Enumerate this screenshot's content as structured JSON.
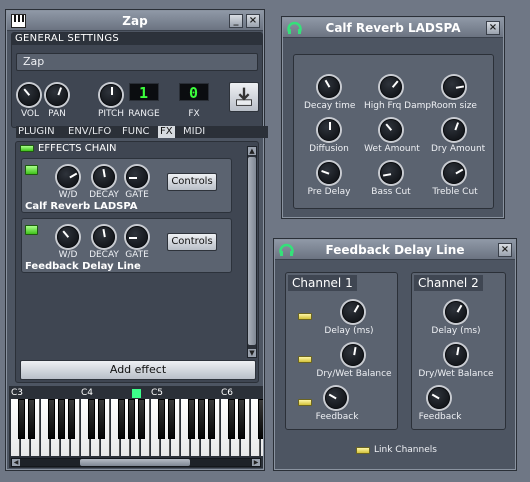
{
  "zap": {
    "title": "Zap",
    "minimize": "_",
    "close": "×",
    "general_settings": "GENERAL SETTINGS",
    "name_value": "Zap",
    "knobs": {
      "vol": "VOL",
      "pan": "PAN",
      "pitch": "PITCH"
    },
    "range_label": "RANGE",
    "range_value": "1",
    "fx_label": "FX",
    "fx_value": "0",
    "tabs": [
      "PLUGIN",
      "ENV/LFO",
      "FUNC",
      "FX",
      "MIDI"
    ],
    "effects_chain_label": "EFFECTS CHAIN",
    "effects": [
      {
        "name": "Calf Reverb LADSPA",
        "wd": "W/D",
        "decay": "DECAY",
        "gate": "GATE",
        "controls": "Controls"
      },
      {
        "name": "Feedback Delay Line",
        "wd": "W/D",
        "decay": "DECAY",
        "gate": "GATE",
        "controls": "Controls"
      }
    ],
    "add_effect": "Add effect",
    "piano_labels": [
      "C3",
      "C4",
      "C5",
      "C6"
    ]
  },
  "reverb": {
    "title": "Calf Reverb LADSPA",
    "close": "×",
    "knobs": [
      "Decay time",
      "High Frq Damp",
      "Room size",
      "Diffusion",
      "Wet Amount",
      "Dry Amount",
      "Pre Delay",
      "Bass Cut",
      "Treble Cut"
    ]
  },
  "delay": {
    "title": "Feedback Delay Line",
    "close": "×",
    "channel1": "Channel 1",
    "channel2": "Channel 2",
    "knob_labels": [
      "Delay (ms)",
      "Dry/Wet Balance",
      "Feedback"
    ],
    "link_channels": "Link Channels"
  },
  "colors": {
    "lcd_green": "#3cff3c",
    "led_yellow": "#f2e35a",
    "led_green": "#6fe03f"
  }
}
